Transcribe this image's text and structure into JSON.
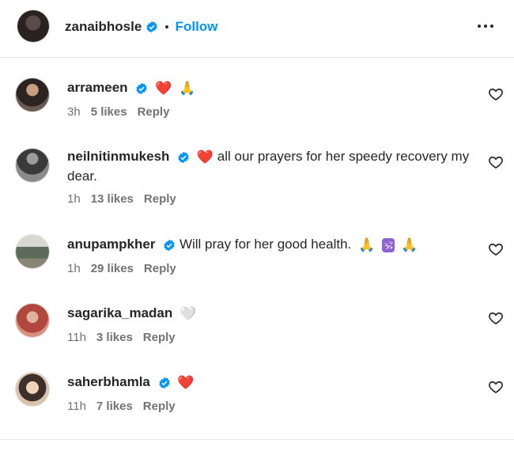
{
  "post": {
    "author": "zanaibhosle",
    "separator": "•",
    "follow_label": "Follow",
    "more_icon": "more-horizontal-icon"
  },
  "comments": [
    {
      "username": "arrameen",
      "verified": true,
      "text": "",
      "emojis": [
        "❤️",
        "🙏"
      ],
      "time": "3h",
      "likes": "5 likes",
      "reply": "Reply"
    },
    {
      "username": "neilnitinmukesh",
      "verified": true,
      "text": "all our prayers for her speedy recovery my dear.",
      "emojis_before": [
        "❤️"
      ],
      "time": "1h",
      "likes": "13 likes",
      "reply": "Reply"
    },
    {
      "username": "anupampkher",
      "verified": true,
      "text": "Will pray for her good health.",
      "emojis_after": [
        "🙏",
        "🕉",
        "🙏"
      ],
      "time": "1h",
      "likes": "29 likes",
      "reply": "Reply"
    },
    {
      "username": "sagarika_madan",
      "verified": false,
      "text": "",
      "emojis": [
        "🤍"
      ],
      "time": "11h",
      "likes": "3 likes",
      "reply": "Reply"
    },
    {
      "username": "saherbhamla",
      "verified": true,
      "text": "",
      "emojis": [
        "❤️"
      ],
      "time": "11h",
      "likes": "7 likes",
      "reply": "Reply"
    }
  ],
  "colors": {
    "accent": "#0095f6",
    "verified": "#0095f6",
    "meta": "#737373",
    "heart": "#e8466a"
  }
}
